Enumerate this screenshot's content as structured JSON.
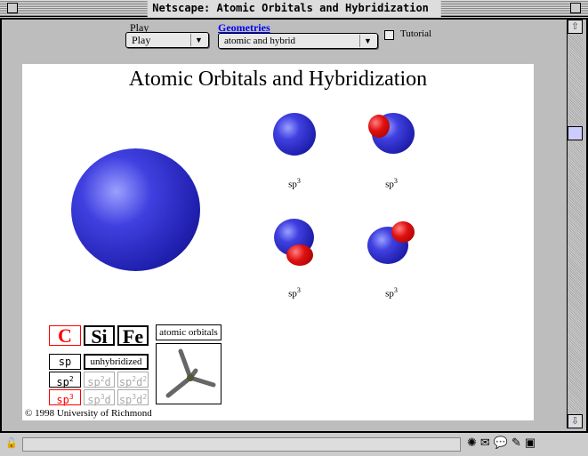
{
  "window": {
    "title": "Netscape: Atomic Orbitals and Hybridization 1.0"
  },
  "controls": {
    "play_label": "Play",
    "play_value": "Play",
    "geometries_label": "Geometries",
    "geometries_value": "atomic and hybrid",
    "tutorial_label": "Tutorial"
  },
  "page": {
    "title": "Atomic Orbitals and Hybridization",
    "orbital_labels": [
      "sp",
      "sp",
      "sp",
      "sp"
    ],
    "orbital_sup": "3",
    "elements": [
      "C",
      "Si",
      "Fe"
    ],
    "hybrid": {
      "sp": "sp",
      "unhybridized": "unhybridized",
      "sp2": "sp",
      "sp2d": "sp",
      "sp2d2": "sp",
      "sp3": "sp",
      "sp3d": "sp",
      "sp3d2": "sp",
      "d": "d",
      "sup2": "2",
      "sup3": "3"
    },
    "atomic_orbitals": "atomic orbitals",
    "copyright": "© 1998 University of Richmond"
  },
  "colors": {
    "selected": "#ff0000",
    "orbital_blue": "#3030d0",
    "orbital_red": "#e01010"
  }
}
